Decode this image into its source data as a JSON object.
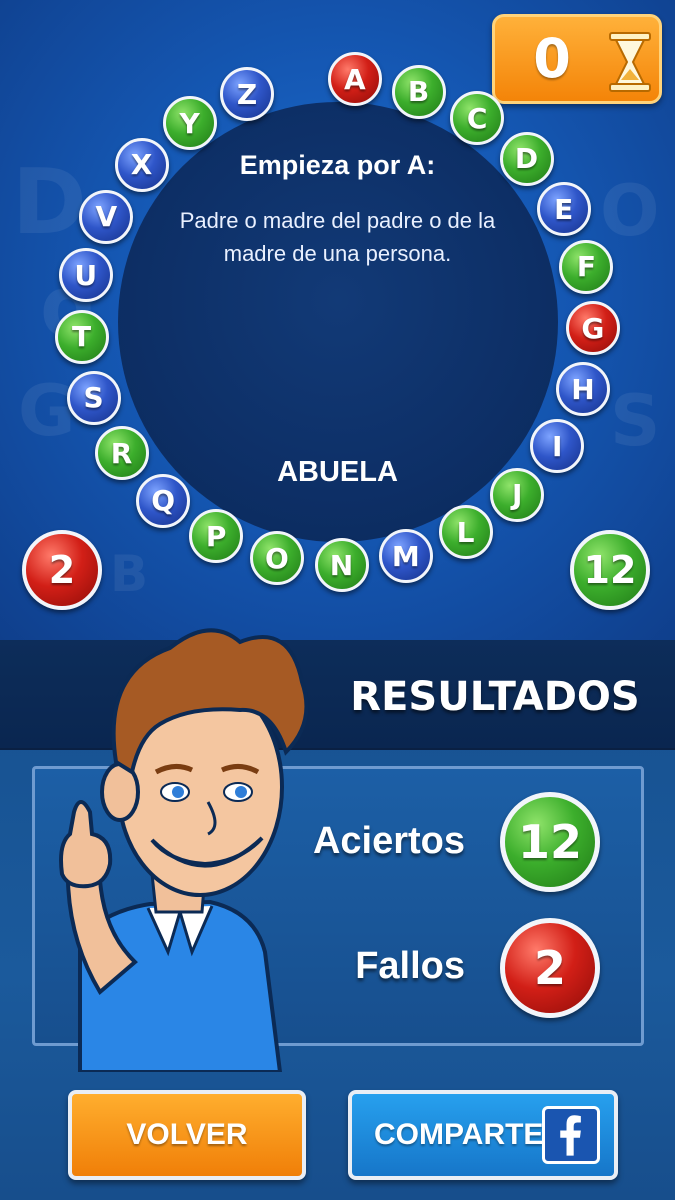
{
  "timer": {
    "value": "0",
    "icon": "hourglass-icon"
  },
  "question": {
    "title": "Empieza por A:",
    "text": "Padre o madre del padre o de la madre de una persona.",
    "answer": "ABUELA"
  },
  "rosco": [
    {
      "letter": "A",
      "status": "red"
    },
    {
      "letter": "B",
      "status": "green"
    },
    {
      "letter": "C",
      "status": "green"
    },
    {
      "letter": "D",
      "status": "green"
    },
    {
      "letter": "E",
      "status": "blue"
    },
    {
      "letter": "F",
      "status": "green"
    },
    {
      "letter": "G",
      "status": "red"
    },
    {
      "letter": "H",
      "status": "blue"
    },
    {
      "letter": "I",
      "status": "blue"
    },
    {
      "letter": "J",
      "status": "green"
    },
    {
      "letter": "L",
      "status": "green"
    },
    {
      "letter": "M",
      "status": "blue"
    },
    {
      "letter": "N",
      "status": "green"
    },
    {
      "letter": "O",
      "status": "green"
    },
    {
      "letter": "P",
      "status": "green"
    },
    {
      "letter": "Q",
      "status": "blue"
    },
    {
      "letter": "R",
      "status": "green"
    },
    {
      "letter": "S",
      "status": "blue"
    },
    {
      "letter": "T",
      "status": "green"
    },
    {
      "letter": "U",
      "status": "blue"
    },
    {
      "letter": "V",
      "status": "blue"
    },
    {
      "letter": "X",
      "status": "blue"
    },
    {
      "letter": "Y",
      "status": "green"
    },
    {
      "letter": "Z",
      "status": "blue"
    }
  ],
  "score": {
    "fallos": "2",
    "aciertos": "12"
  },
  "results": {
    "title": "RESULTADOS",
    "aciertos_label": "Aciertos",
    "aciertos_value": "12",
    "fallos_label": "Fallos",
    "fallos_value": "2"
  },
  "buttons": {
    "back": "VOLVER",
    "share": "COMPARTE"
  },
  "colors": {
    "correct": "#3cae2c",
    "wrong": "#d21f17",
    "pending": "#2f56c9",
    "accent": "#f48408"
  }
}
